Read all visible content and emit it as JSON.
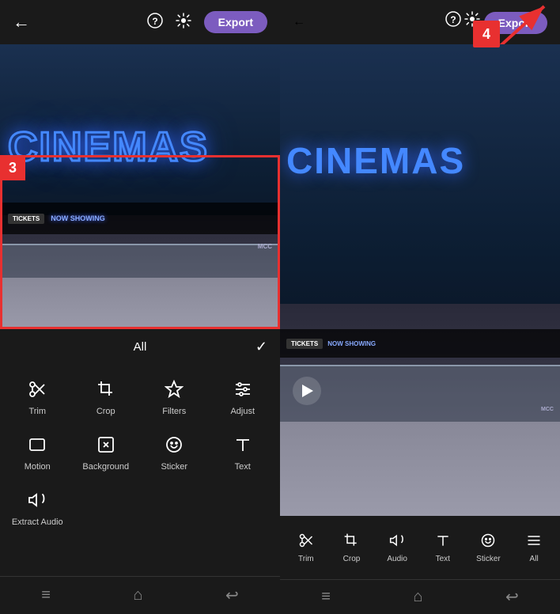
{
  "left": {
    "header": {
      "back_icon": "←",
      "help_icon": "?",
      "settings_icon": "⚙",
      "export_label": "Export"
    },
    "cinema_text": "CINEMAS",
    "tools": {
      "header_title": "All",
      "header_check": "✓",
      "items": [
        {
          "id": "trim",
          "icon": "✂",
          "label": "Trim"
        },
        {
          "id": "crop",
          "icon": "⬚",
          "label": "Crop"
        },
        {
          "id": "filters",
          "icon": "✳",
          "label": "Filters"
        },
        {
          "id": "adjust",
          "icon": "≡",
          "label": "Adjust"
        },
        {
          "id": "motion",
          "icon": "▭",
          "label": "Motion"
        },
        {
          "id": "background",
          "icon": "⊘",
          "label": "Background"
        },
        {
          "id": "sticker",
          "icon": "☺",
          "label": "Sticker"
        },
        {
          "id": "text",
          "icon": "T",
          "label": "Text"
        },
        {
          "id": "extract-audio",
          "icon": "🔊",
          "label": "Extract Audio"
        }
      ]
    },
    "step3": "3",
    "bottom_nav": [
      "≡",
      "⌂",
      "↩"
    ]
  },
  "right": {
    "header": {
      "back_icon": "←",
      "help_icon": "?",
      "settings_icon": "⚙",
      "export_label": "Export"
    },
    "step4": "4",
    "cinema_text": "CINEMAS",
    "toolbar": {
      "items": [
        {
          "id": "trim",
          "icon": "✂",
          "label": "Trim"
        },
        {
          "id": "crop",
          "icon": "⬚",
          "label": "Crop"
        },
        {
          "id": "audio",
          "icon": "🔊",
          "label": "Audio"
        },
        {
          "id": "text",
          "icon": "T",
          "label": "Text"
        },
        {
          "id": "sticker",
          "icon": "☺",
          "label": "Sticker"
        },
        {
          "id": "filters",
          "icon": "≡",
          "label": "All"
        }
      ]
    },
    "bottom_nav": [
      "≡",
      "⌂",
      "↩"
    ]
  }
}
